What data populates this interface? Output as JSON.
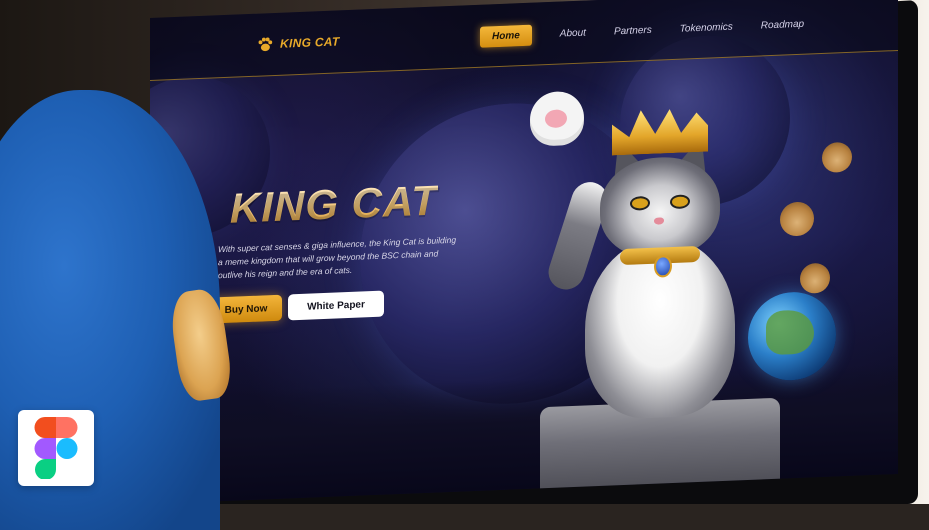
{
  "brand": {
    "name": "KING CAT",
    "logo_icon": "paw-icon"
  },
  "nav": {
    "items": [
      {
        "label": "Home",
        "active": true
      },
      {
        "label": "About",
        "active": false
      },
      {
        "label": "Partners",
        "active": false
      },
      {
        "label": "Tokenomics",
        "active": false
      },
      {
        "label": "Roadmap",
        "active": false
      }
    ]
  },
  "hero": {
    "title": "KING CAT",
    "description": "With super cat senses & giga influence, the King Cat is building a meme kingdom that will grow beyond the BSC chain and outlive his reign and the era of cats.",
    "buttons": {
      "primary": "Buy Now",
      "secondary": "White Paper"
    }
  },
  "badge": {
    "icon": "figma-icon"
  },
  "colors": {
    "accent": "#e7a92a",
    "background": "#0e0d22",
    "button_primary": "#f3b53b",
    "button_secondary": "#ffffff"
  }
}
